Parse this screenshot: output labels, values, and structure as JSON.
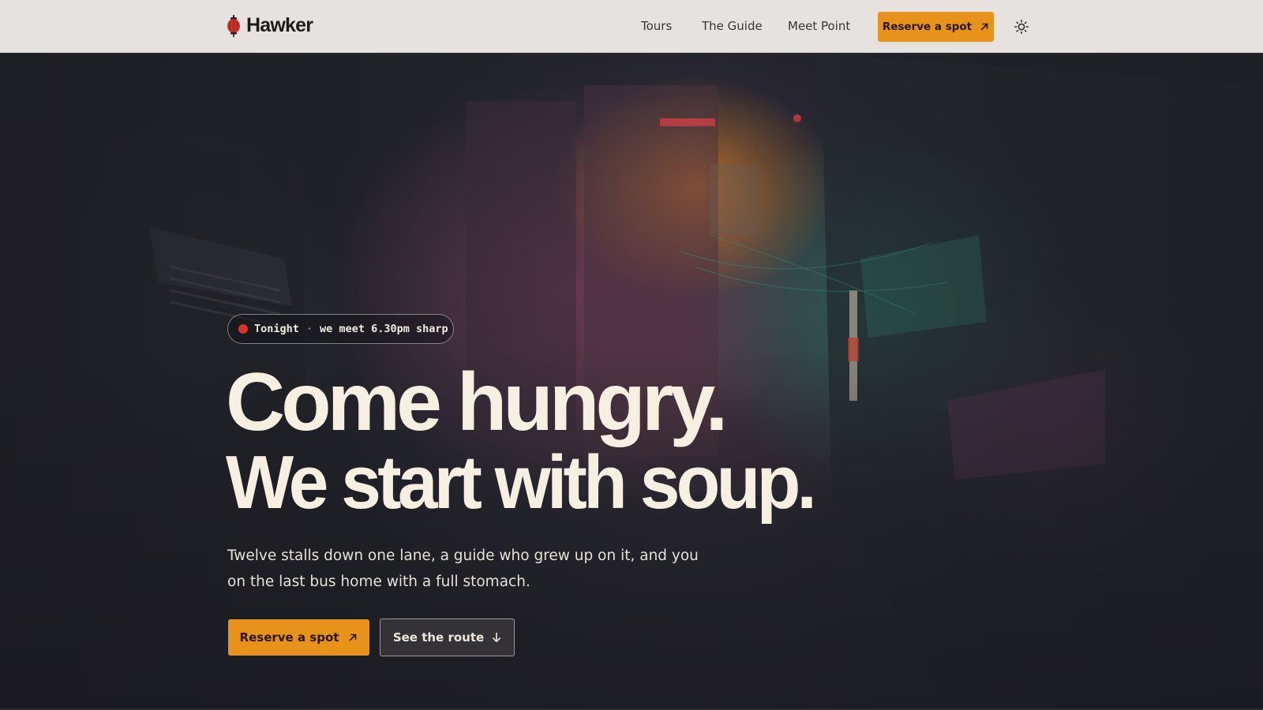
{
  "header": {
    "brand_name": "Hawker",
    "brand_icon": "lantern-icon",
    "nav": [
      {
        "label": "Tours"
      },
      {
        "label": "The Guide"
      },
      {
        "label": "Meet Point"
      }
    ],
    "cta_label": "Reserve a spot",
    "cta_icon": "arrow-up-right-icon",
    "theme_icon": "sun-icon"
  },
  "hero": {
    "badge": {
      "status": "Tonight",
      "separator": "·",
      "detail": "we meet 6.30pm sharp",
      "dot_icon": "live-dot-icon"
    },
    "headline_line1": "Come hungry.",
    "headline_line2": "We start with soup.",
    "lede": "Twelve stalls down one lane, a guide who grew up on it, and you on the last bus home with a full stomach.",
    "primary_button": "Reserve a spot",
    "primary_icon": "arrow-up-right-icon",
    "secondary_button": "See the route",
    "secondary_icon": "arrow-down-icon"
  },
  "colors": {
    "accent": "#e6921b",
    "nav_background": "#e6e2df",
    "live_dot": "#d8322b",
    "headline": "#f6efe2"
  }
}
